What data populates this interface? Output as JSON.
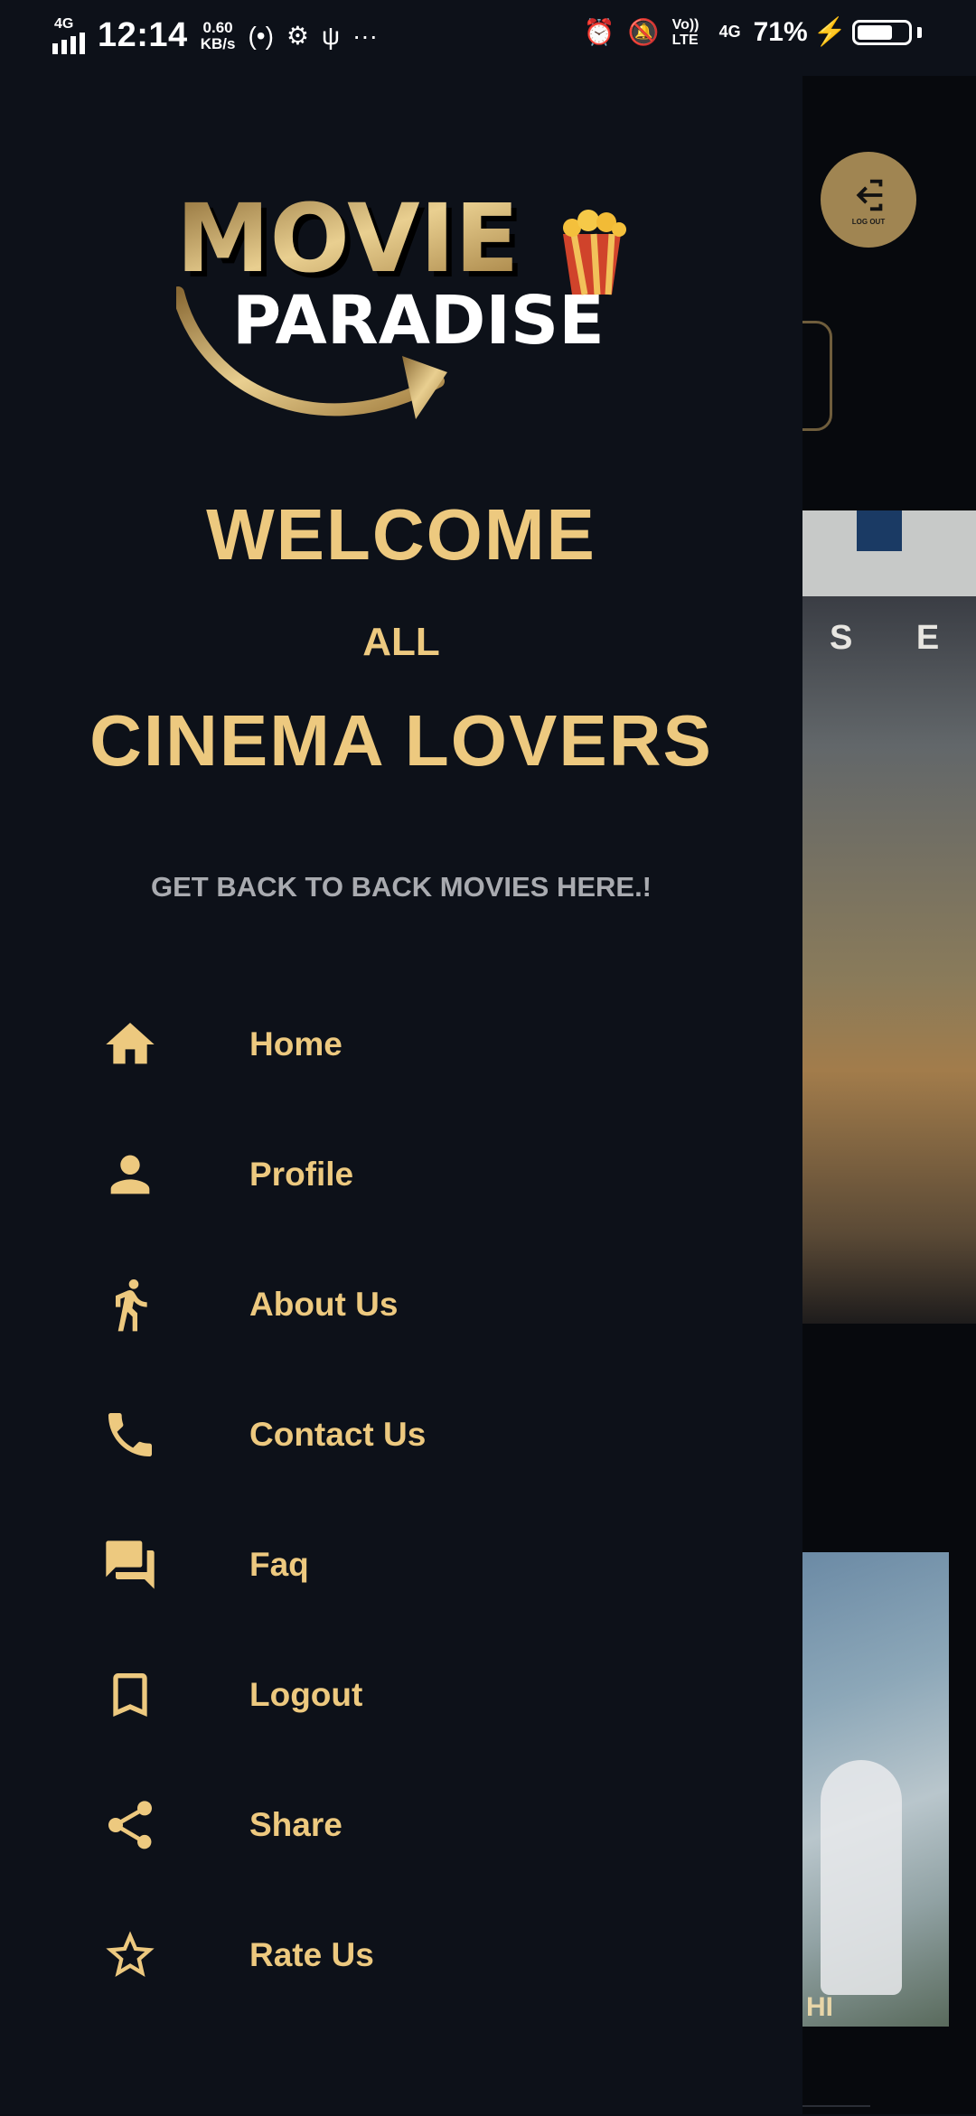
{
  "status_bar": {
    "network_tag": "4G",
    "time": "12:14",
    "speed_value": "0.60",
    "speed_unit": "KB/s",
    "more": "···",
    "volte": "Vo)) LTE",
    "network_right": "4G",
    "battery_percent": "71%",
    "battery_level": 0.71
  },
  "drawer": {
    "logo_line1": "MOVIE",
    "logo_line2": "PARADISE",
    "welcome": "WELCOME",
    "all": "ALL",
    "cinema_lovers": "CINEMA LOVERS",
    "tagline": "GET BACK TO BACK MOVIES HERE.!",
    "menu": [
      {
        "label": "Home",
        "icon": "home-icon"
      },
      {
        "label": "Profile",
        "icon": "person-icon"
      },
      {
        "label": "About Us",
        "icon": "walking-person-icon"
      },
      {
        "label": "Contact Us",
        "icon": "phone-icon"
      },
      {
        "label": "Faq",
        "icon": "chat-bubbles-icon"
      },
      {
        "label": "Logout",
        "icon": "bookmark-icon"
      },
      {
        "label": "Share",
        "icon": "share-icon"
      },
      {
        "label": "Rate Us",
        "icon": "star-icon"
      }
    ]
  },
  "background": {
    "logout_button_label": "LOG OUT",
    "banner_letters": "S E",
    "poster_caption": "HI"
  },
  "colors": {
    "accent": "#edc97f",
    "drawer_bg": "#0d1119",
    "tagline": "#a9abb0"
  }
}
